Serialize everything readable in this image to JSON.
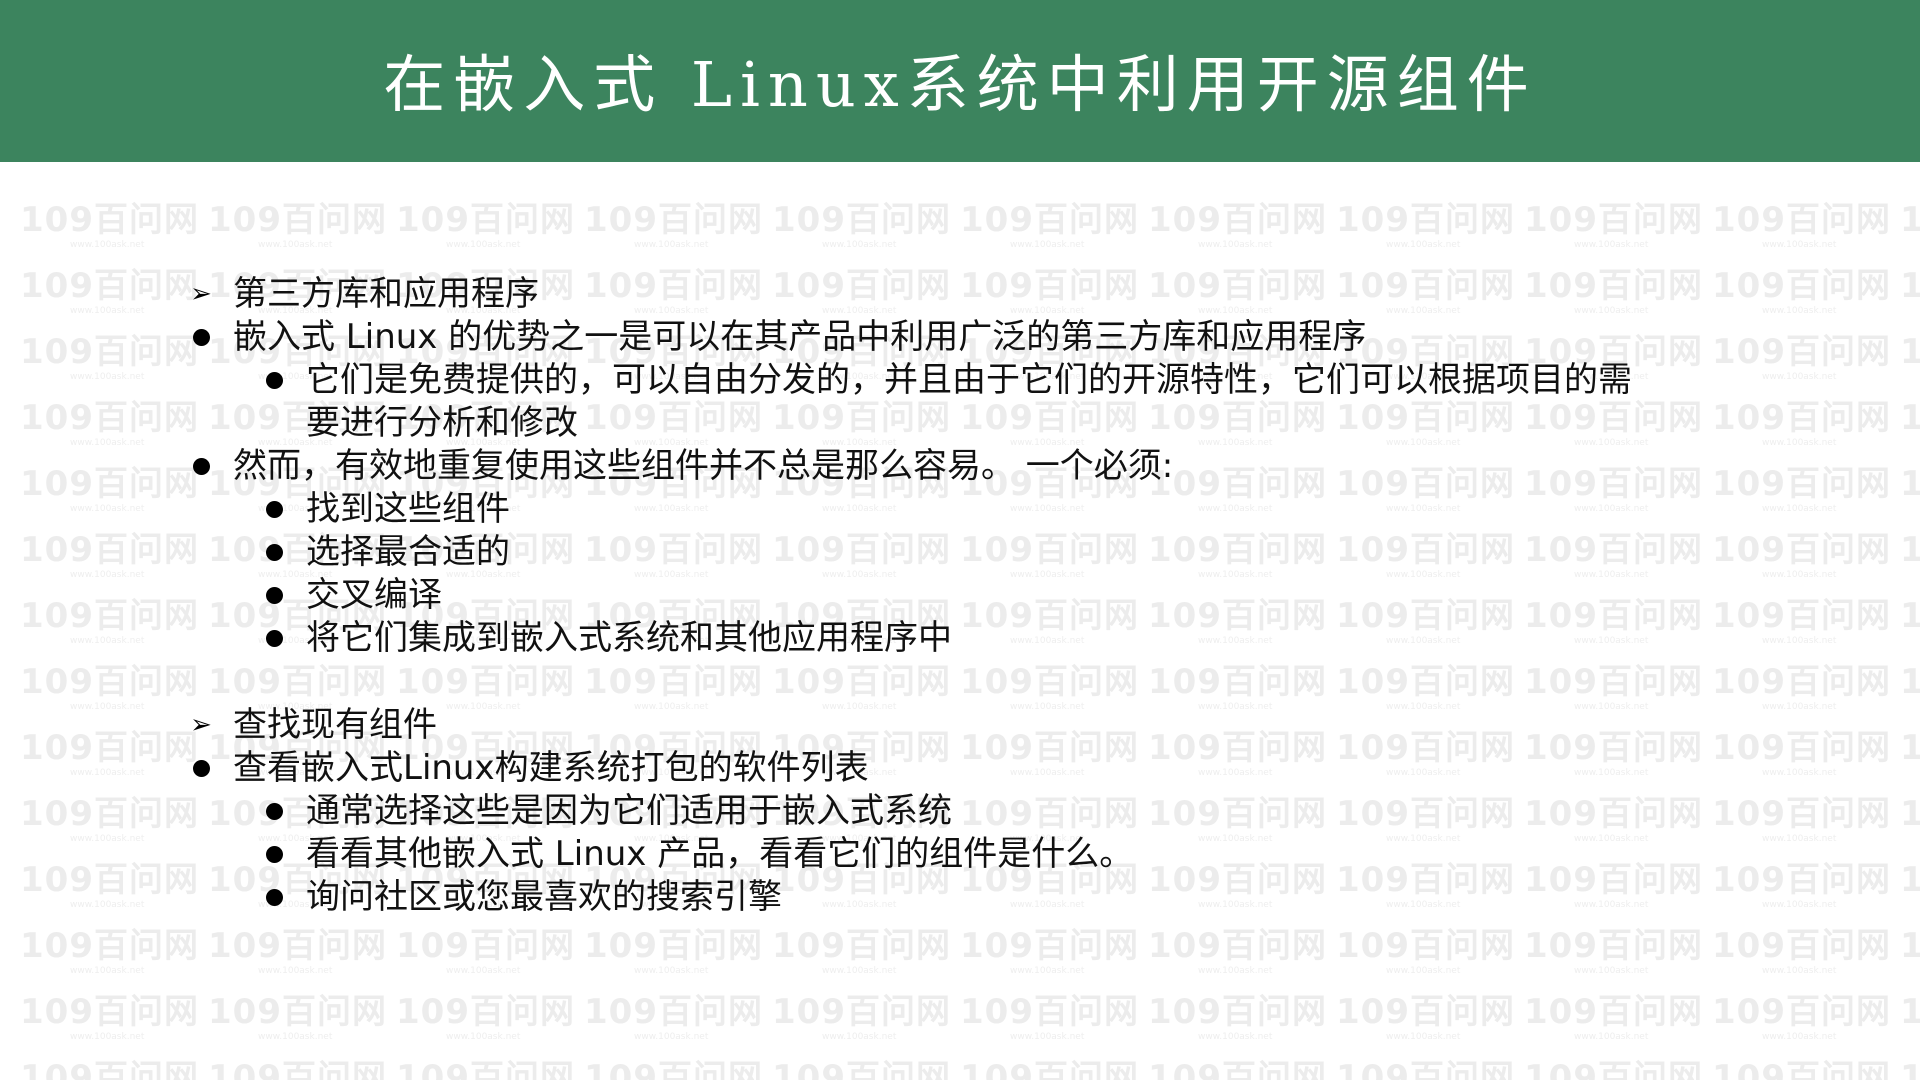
{
  "slide": {
    "title": "在嵌入式 Linux系统中利用开源组件"
  },
  "watermark": {
    "text": "109百问网",
    "subtext": "www.100ask.net"
  },
  "sections": [
    {
      "heading": "第三方库和应用程序",
      "l1_a": "嵌入式 Linux 的优势之一是可以在其产品中利用广泛的第三方库和应用程序",
      "l2_a_line1": "它们是免费提供的，可以自由分发的，并且由于它们的开源特性，它们可以根据项目的需",
      "l2_a_line2": "要进行分析和修改",
      "l1_b": "然而，有效地重复使用这些组件并不总是那么容易。 一个必须:",
      "l2_items": [
        "找到这些组件",
        "选择最合适的",
        "交叉编译",
        "将它们集成到嵌入式系统和其他应用程序中"
      ]
    },
    {
      "heading": "查找现有组件",
      "l1_a": "查看嵌入式Linux构建系统打包的软件列表",
      "l2_items": [
        "通常选择这些是因为它们适用于嵌入式系统",
        "看看其他嵌入式 Linux 产品，看看它们的组件是什么。",
        "询问社区或您最喜欢的搜索引擎"
      ]
    }
  ],
  "colors": {
    "title_bar": "#3c845e",
    "title_text": "#ffffff",
    "body_text": "#111111"
  }
}
